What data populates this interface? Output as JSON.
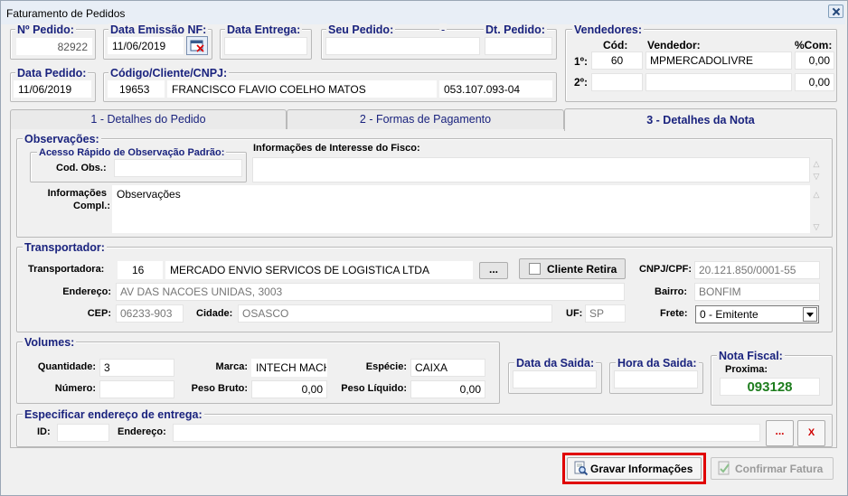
{
  "window": {
    "title": "Faturamento de Pedidos"
  },
  "header": {
    "num_pedido": {
      "label": "Nº Pedido:",
      "value": "82922"
    },
    "data_emissao": {
      "label": "Data Emissão NF:",
      "value": "11/06/2019"
    },
    "data_entrega": {
      "label": "Data Entrega:",
      "value": ""
    },
    "seu_pedido": {
      "label": "Seu Pedido:",
      "dash": "-",
      "value": ""
    },
    "dt_pedido": {
      "label": "Dt. Pedido:",
      "value": ""
    },
    "data_pedido": {
      "label": "Data Pedido:",
      "value": "11/06/2019"
    },
    "cliente": {
      "label": "Código/Cliente/CNPJ:",
      "code": "19653",
      "name": "FRANCISCO FLAVIO COELHO MATOS",
      "cnpj": "053.107.093-04"
    }
  },
  "vendedores": {
    "legend": "Vendedores:",
    "col_cod": "Cód:",
    "col_vendedor": "Vendedor:",
    "col_com": "%Com:",
    "rows": [
      {
        "label": "1º:",
        "cod": "60",
        "nome": "MPMERCADOLIVRE",
        "com": "0,00"
      },
      {
        "label": "2º:",
        "cod": "",
        "nome": "",
        "com": "0,00"
      }
    ]
  },
  "tabs": [
    {
      "label": "1 - Detalhes do Pedido"
    },
    {
      "label": "2 - Formas de Pagamento"
    },
    {
      "label": "3 - Detalhes da Nota"
    }
  ],
  "observacoes": {
    "legend": "Observações:",
    "acesso_legend": "Acesso Rápido de Observação Padrão:",
    "cod_obs_label": "Cod. Obs.:",
    "cod_obs_value": "",
    "fisco_label": "Informações de Interesse do Fisco:",
    "fisco_value": "",
    "compl_label_1": "Informações",
    "compl_label_2": "Compl.:",
    "compl_value": "Observações"
  },
  "transportador": {
    "legend": "Transportador:",
    "transportadora_label": "Transportadora:",
    "code": "16",
    "name": "MERCADO ENVIO SERVICOS DE LOGISTICA LTDA",
    "browse_label": "...",
    "cliente_retira_label": "Cliente Retira",
    "cnpj_label": "CNPJ/CPF:",
    "cnpj_value": "20.121.850/0001-55",
    "endereco_label": "Endereço:",
    "endereco_value": "AV DAS NACOES UNIDAS, 3003",
    "bairro_label": "Bairro:",
    "bairro_value": "BONFIM",
    "cep_label": "CEP:",
    "cep_value": "06233-903",
    "cidade_label": "Cidade:",
    "cidade_value": "OSASCO",
    "uf_label": "UF:",
    "uf_value": "SP",
    "frete_label": "Frete:",
    "frete_value": "0 - Emitente"
  },
  "volumes": {
    "legend": "Volumes:",
    "quantidade_label": "Quantidade:",
    "quantidade_value": "3",
    "marca_label": "Marca:",
    "marca_value": "INTECH MACH",
    "especie_label": "Espécie:",
    "especie_value": "CAIXA",
    "numero_label": "Número:",
    "numero_value": "",
    "peso_bruto_label": "Peso Bruto:",
    "peso_bruto_value": "0,00",
    "peso_liquido_label": "Peso Líquido:",
    "peso_liquido_value": "0,00"
  },
  "saida": {
    "data_legend": "Data da Saida:",
    "data_value": "",
    "hora_legend": "Hora da Saida:",
    "hora_value": ""
  },
  "nota_fiscal": {
    "legend": "Nota Fiscal:",
    "proxima_label": "Proxima:",
    "proxima_value": "093128",
    "value_color": "#1e7d1e"
  },
  "entrega": {
    "legend": "Especificar endereço de entrega:",
    "id_label": "ID:",
    "id_value": "",
    "endereco_label": "Endereço:",
    "endereco_value": "",
    "browse_label": "...",
    "clear_label": "X"
  },
  "footer": {
    "gravar_label": "Gravar Informações",
    "confirmar_label": "Confirmar Fatura",
    "highlight_color": "#e00000"
  },
  "icons": [
    "calendar-clear-icon",
    "search-doc-icon",
    "confirm-doc-icon",
    "close-icon"
  ]
}
